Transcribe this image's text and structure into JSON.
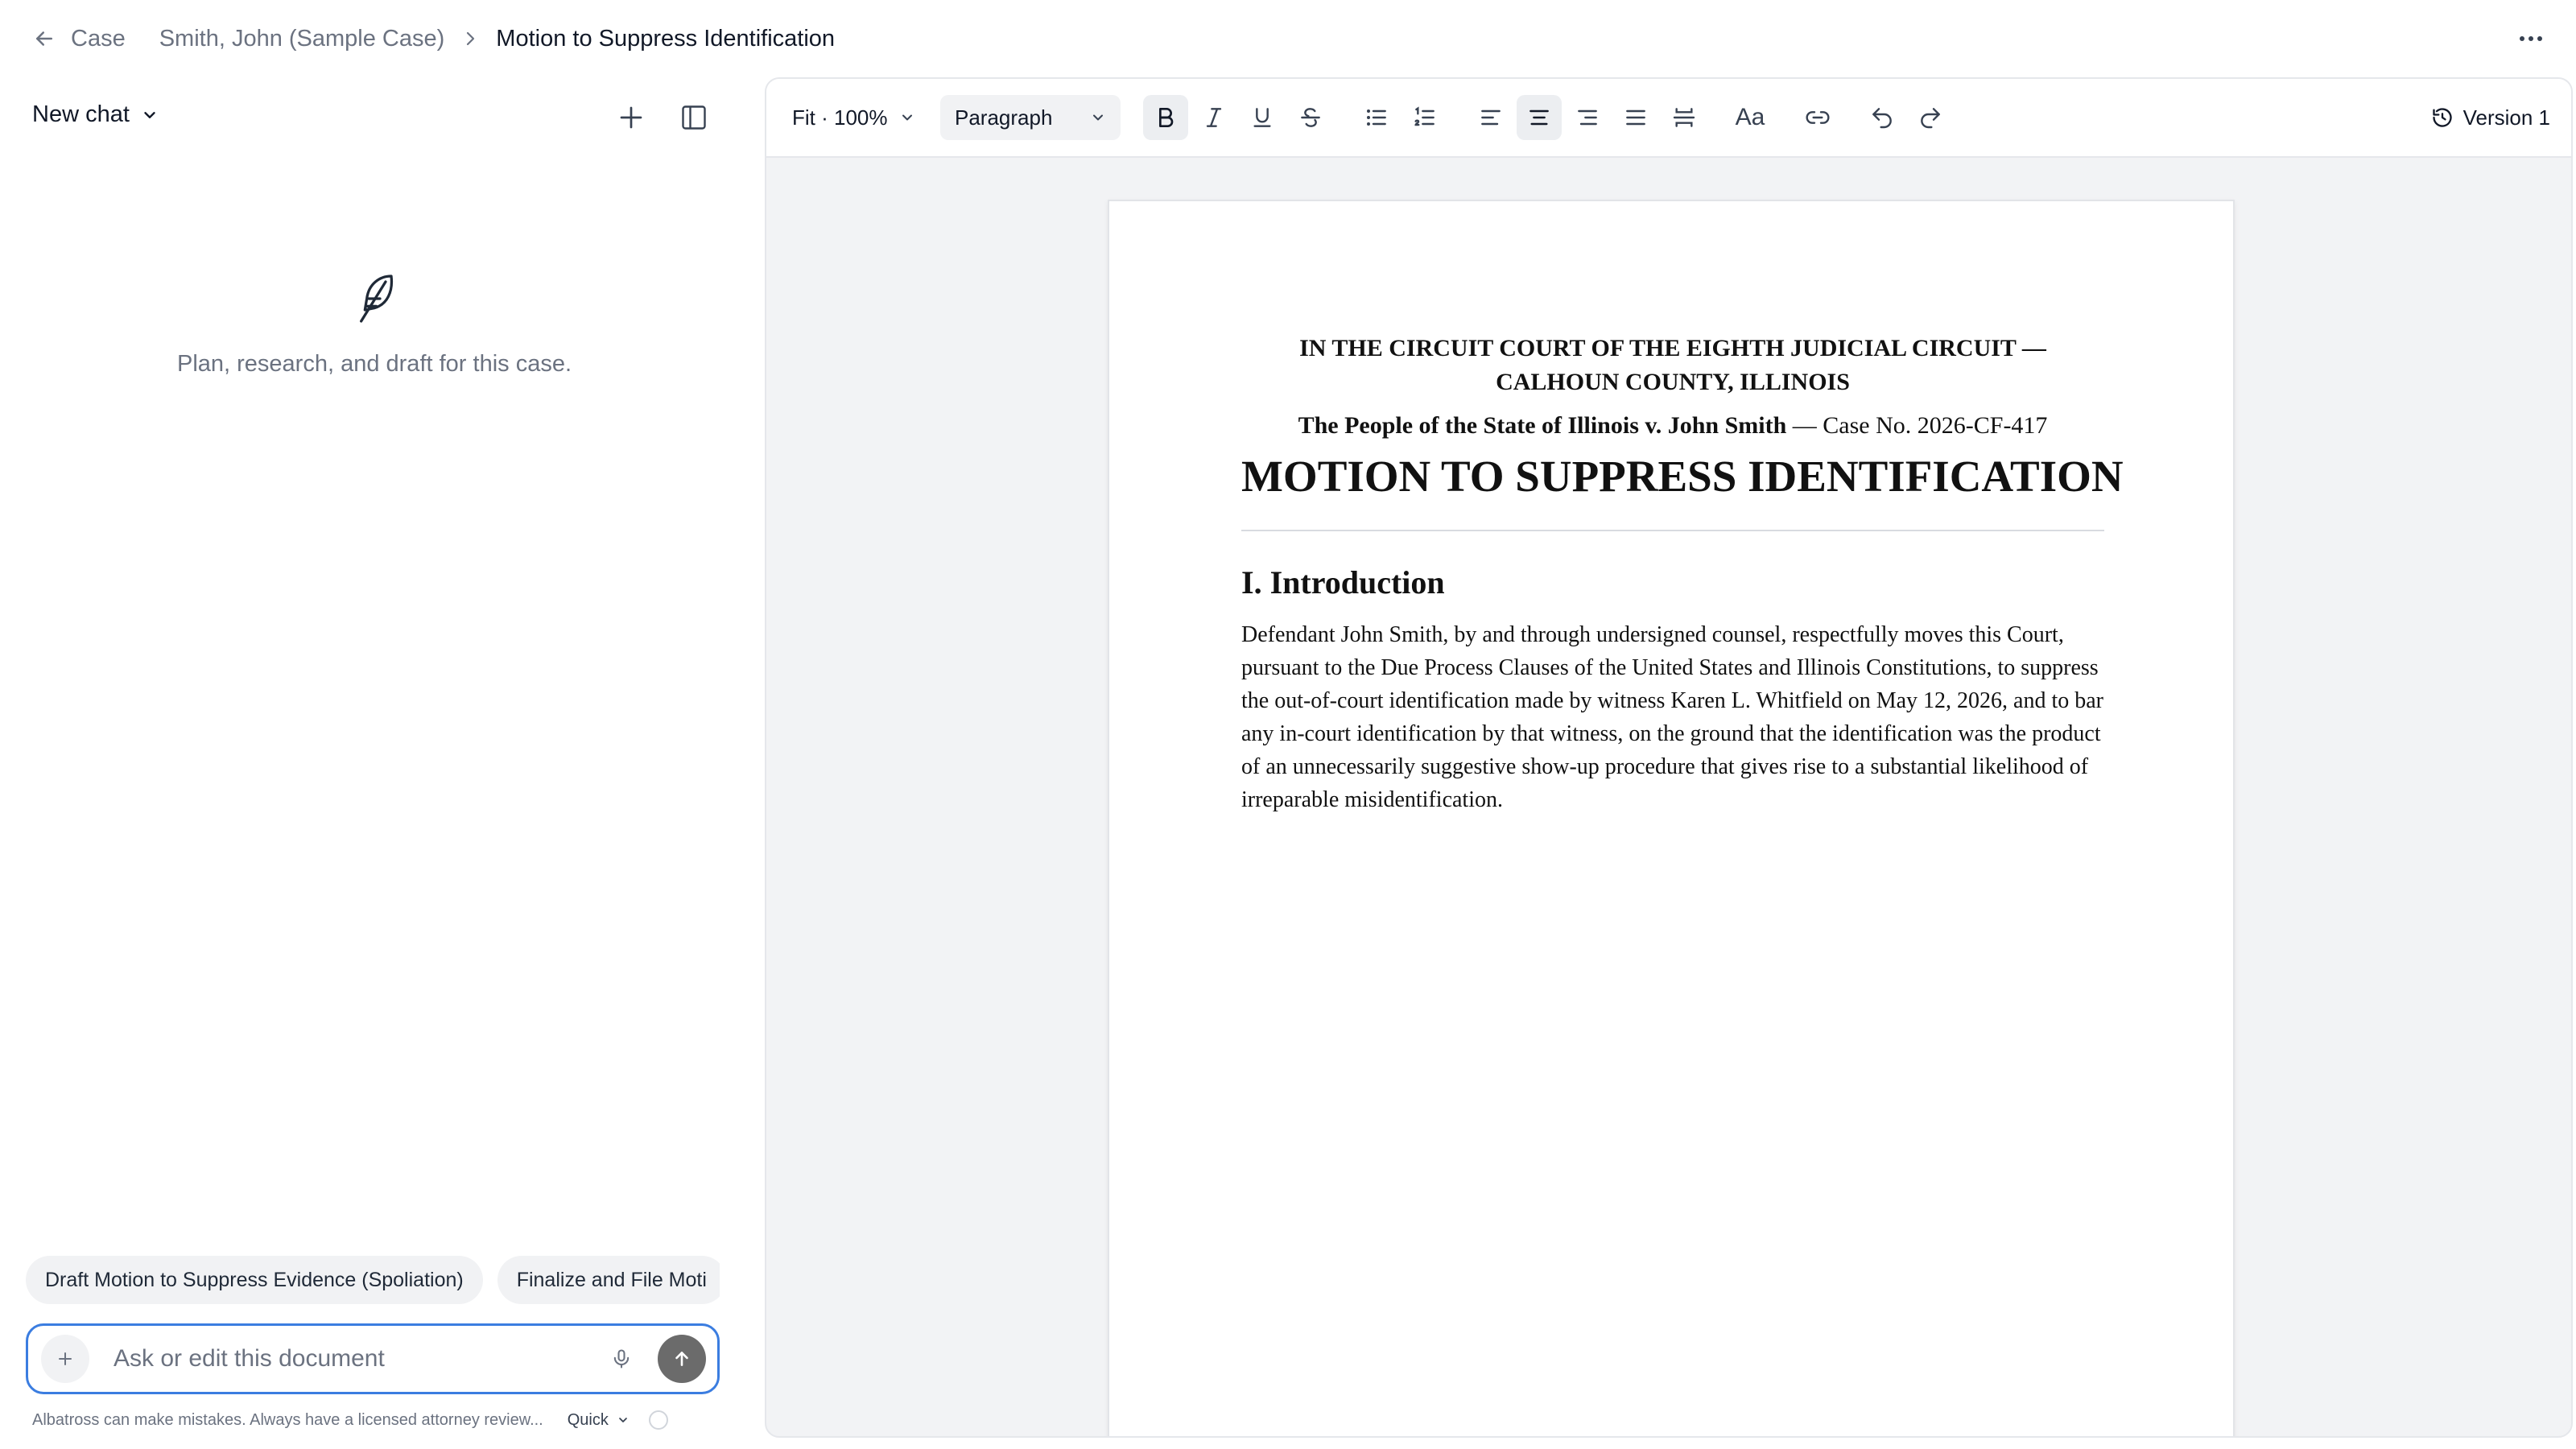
{
  "breadcrumb": {
    "back_label": "Case",
    "case_name": "Smith, John (Sample Case)",
    "current": "Motion to Suppress Identification"
  },
  "chat": {
    "title": "New chat",
    "empty_text": "Plan, research, and draft for this case.",
    "empty_icon": "feather-icon",
    "suggestions": [
      "Draft Motion to Suppress Evidence (Spoliation)",
      "Finalize and File Moti"
    ],
    "input_placeholder": "Ask or edit this document",
    "input_value": "",
    "disclaimer": "Albatross can make mistakes. Always have a licensed attorney review...",
    "mode": "Quick"
  },
  "toolbar": {
    "zoom": "Fit · 100%",
    "block_style": "Paragraph",
    "font_button": "Aa",
    "version": "Version 1"
  },
  "document": {
    "court_line1": "IN THE CIRCUIT COURT OF THE EIGHTH JUDICIAL CIRCUIT —",
    "court_line2": "CALHOUN COUNTY, ILLINOIS",
    "parties": "The People of the State of Illinois v. John Smith",
    "case_number": " — Case No. 2026-CF-417",
    "title": "MOTION TO SUPPRESS IDENTIFICATION",
    "section_heading": "I. Introduction",
    "paragraph": "Defendant John Smith, by and through undersigned counsel, respectfully moves this Court, pursuant to the Due Process Clauses of the United States and Illinois Constitutions, to suppress the out-of-court identification made by witness Karen L. Whitfield on May 12, 2026, and to bar any in-court identification by that witness, on the ground that the identification was the product of an unnecessarily suggestive show-up procedure that gives rise to a substantial likelihood of irreparable misidentification."
  },
  "colors": {
    "accent": "#3b7de0",
    "send_button": "#6b6b6b",
    "editor_background": "#f2f3f5",
    "muted_text": "#6b7280"
  }
}
